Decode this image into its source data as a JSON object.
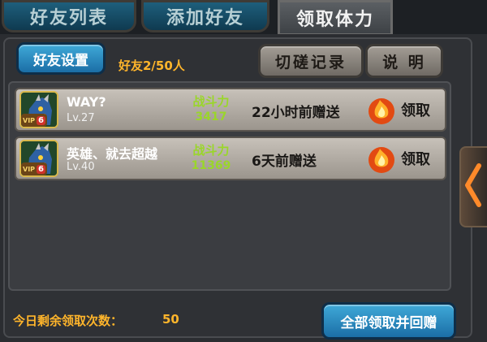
{
  "tabs": [
    {
      "label": "好友列表",
      "active": false
    },
    {
      "label": "添加好友",
      "active": false
    },
    {
      "label": "领取体力",
      "active": true
    }
  ],
  "toolbar": {
    "friend_settings": "好友设置",
    "friend_count": "好友2/50人",
    "spar_record": "切磋记录",
    "explain": "说 明"
  },
  "friends": [
    {
      "name": "WAY?",
      "level": "Lv.27",
      "power_label": "战斗力",
      "power": "3417",
      "gift_time": "22小时前赠送",
      "vip_label": "VIP",
      "vip_level": "6",
      "claim_label": "领取"
    },
    {
      "name": "英雄、就去超越",
      "level": "Lv.40",
      "power_label": "战斗力",
      "power": "11369",
      "gift_time": "6天前赠送",
      "vip_label": "VIP",
      "vip_level": "6",
      "claim_label": "领取"
    }
  ],
  "footer": {
    "remain_label": "今日剩余领取次数：",
    "remain_value": "50",
    "claim_all": "全部领取并回赠"
  },
  "colors": {
    "accent_orange": "#ffb52b",
    "power_green": "#9ad62a",
    "button_blue": "#2f8dc4"
  },
  "icons": {
    "claim": "flame-icon",
    "avatar": "dragon-avatar-icon",
    "side": "chevron-left-icon"
  }
}
